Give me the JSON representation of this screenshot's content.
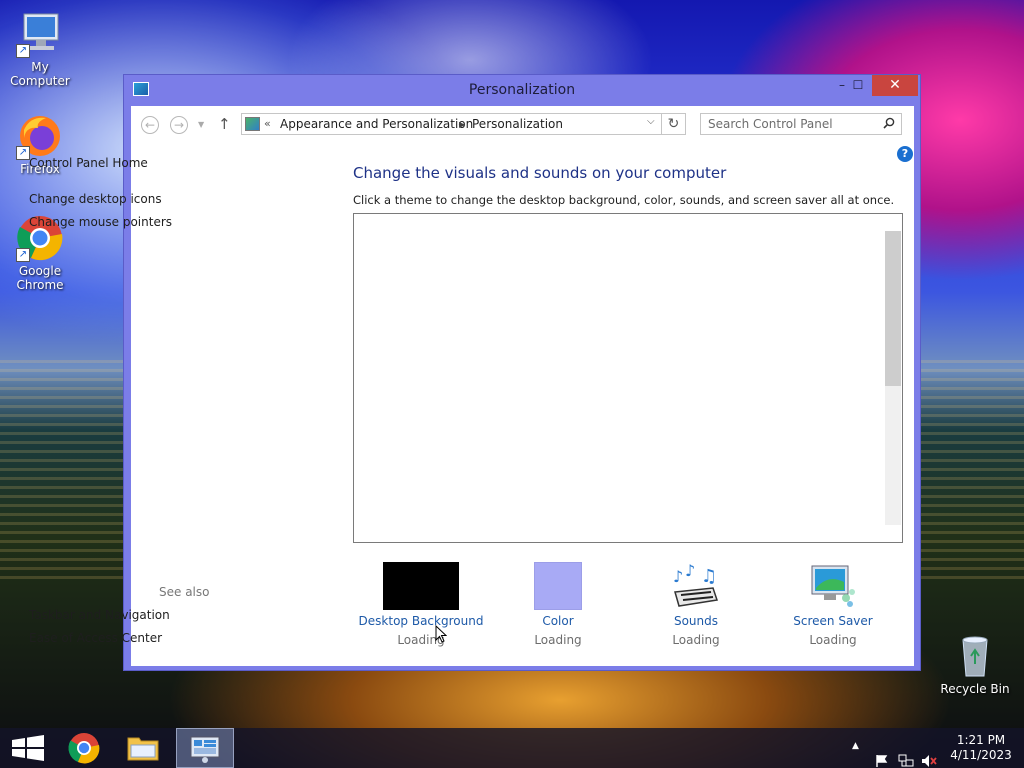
{
  "desktop": {
    "icons": [
      {
        "label": "My Computer"
      },
      {
        "label": "Firefox"
      },
      {
        "label": "Google Chrome"
      },
      {
        "label": "Recycle Bin"
      }
    ]
  },
  "window": {
    "title": "Personalization",
    "controls": {
      "minimize": "–",
      "maximize": "☐",
      "close": "✕"
    }
  },
  "address_bar": {
    "overflow": "«",
    "breadcrumbs": [
      "Appearance and Personalization",
      "Personalization"
    ],
    "search_placeholder": "Search Control Panel"
  },
  "left_pane": {
    "home": "Control Panel Home",
    "links": [
      "Change desktop icons",
      "Change mouse pointers"
    ],
    "see_also_header": "See also",
    "see_also_links": [
      "Taskbar and Navigation",
      "Ease of Access Center"
    ]
  },
  "main": {
    "heading": "Change the visuals and sounds on your computer",
    "description": "Click a theme to change the desktop background, color, sounds, and screen saver all at once.",
    "settings": [
      {
        "label": "Desktop Background",
        "status": "Loading"
      },
      {
        "label": "Color",
        "status": "Loading"
      },
      {
        "label": "Sounds",
        "status": "Loading"
      },
      {
        "label": "Screen Saver",
        "status": "Loading"
      }
    ]
  },
  "taskbar": {
    "time": "1:21 PM",
    "date": "4/11/2023"
  },
  "colors": {
    "window_frame": "#7b7de8",
    "link_blue": "#1e5aa8",
    "heading_blue": "#1e3287",
    "close_red": "#c9453f",
    "color_swatch": "#a8aaf5"
  }
}
